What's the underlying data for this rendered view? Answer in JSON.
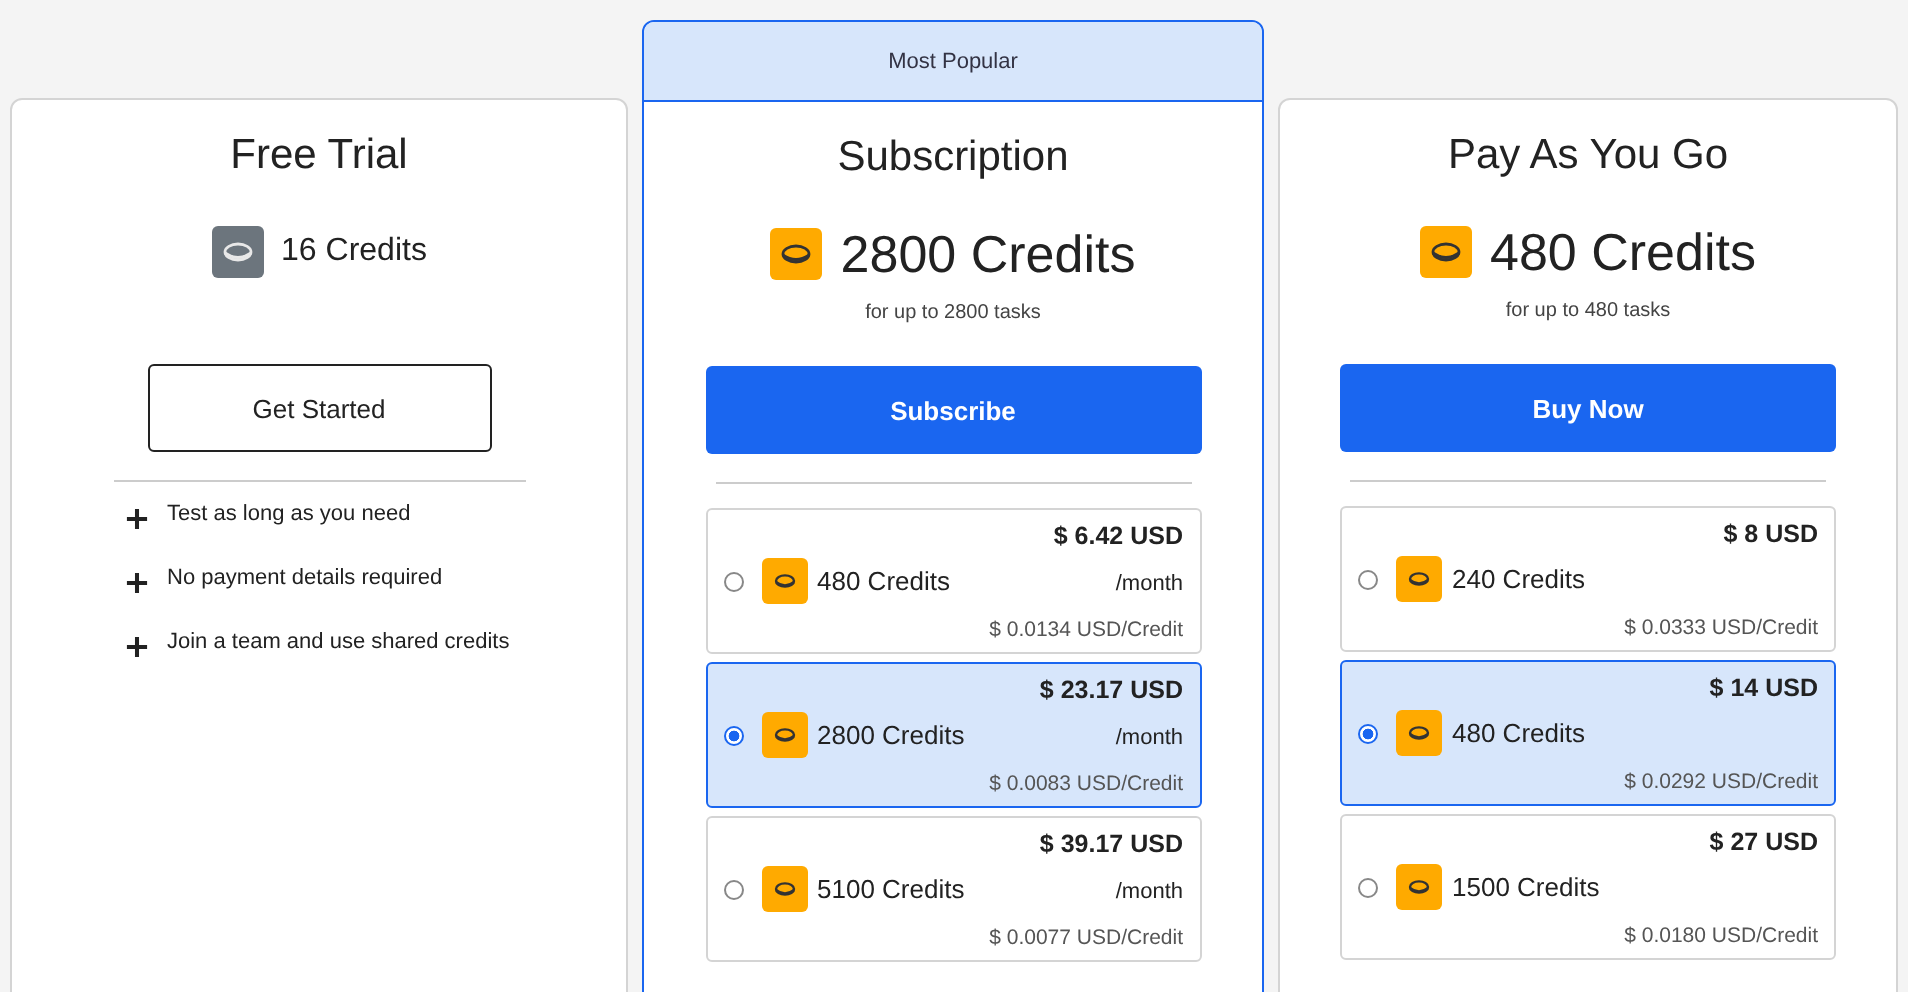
{
  "plans": [
    {
      "kind": "trial",
      "title": "Free Trial",
      "credits": "16 Credits",
      "button": {
        "label": "Get Started",
        "kind": "outline"
      },
      "features": [
        "Test as long as you need",
        "No payment details required",
        "Join a team and use shared credits"
      ]
    },
    {
      "kind": "paid",
      "badge": "Most Popular",
      "title": "Subscription",
      "credits": "2800 Credits",
      "tasks": "for up to 2800 tasks",
      "button": {
        "label": "Subscribe",
        "kind": "primary"
      },
      "options": [
        {
          "credits": "480 Credits",
          "price": "$ 6.42 USD",
          "period": "/month",
          "unit_price": "$ 0.0134 USD/Credit",
          "selected": false
        },
        {
          "credits": "2800 Credits",
          "price": "$ 23.17 USD",
          "period": "/month",
          "unit_price": "$ 0.0083 USD/Credit",
          "selected": true
        },
        {
          "credits": "5100 Credits",
          "price": "$ 39.17 USD",
          "period": "/month",
          "unit_price": "$ 0.0077 USD/Credit",
          "selected": false
        }
      ]
    },
    {
      "kind": "paid",
      "title": "Pay As You Go",
      "credits": "480 Credits",
      "tasks": "for up to 480 tasks",
      "button": {
        "label": "Buy Now",
        "kind": "primary"
      },
      "options": [
        {
          "credits": "240 Credits",
          "price": "$ 8 USD",
          "unit_price": "$ 0.0333 USD/Credit",
          "selected": false
        },
        {
          "credits": "480 Credits",
          "price": "$ 14 USD",
          "unit_price": "$ 0.0292 USD/Credit",
          "selected": true
        },
        {
          "credits": "1500 Credits",
          "price": "$ 27 USD",
          "unit_price": "$ 0.0180 USD/Credit",
          "selected": false
        }
      ]
    }
  ]
}
